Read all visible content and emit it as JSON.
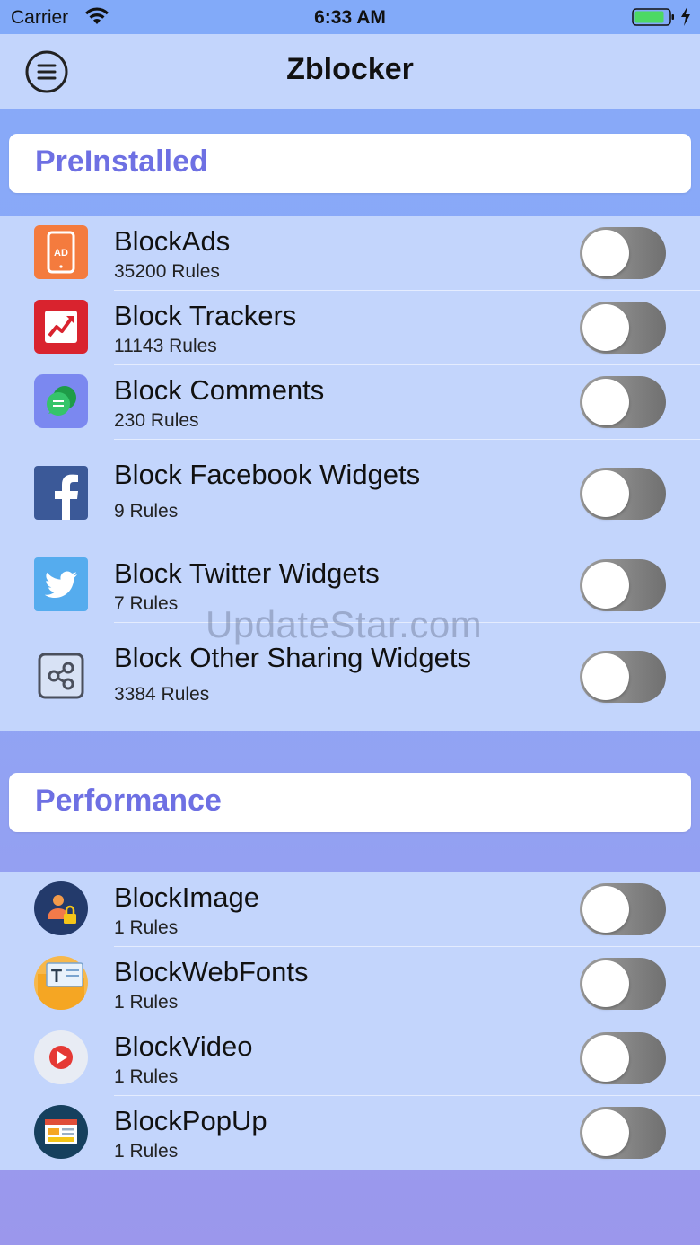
{
  "status_bar": {
    "carrier": "Carrier",
    "time": "6:33 AM"
  },
  "navbar": {
    "title": "Zblocker",
    "menu_icon": "menu-circle-icon"
  },
  "sections": [
    {
      "title": "PreInstalled",
      "items": [
        {
          "name": "BlockAds",
          "rules": "35200 Rules",
          "icon": "ad-phone-icon",
          "enabled": false
        },
        {
          "name": "Block Trackers",
          "rules": "11143 Rules",
          "icon": "trend-chart-icon",
          "enabled": false
        },
        {
          "name": "Block Comments",
          "rules": "230 Rules",
          "icon": "chat-bubbles-icon",
          "enabled": false
        },
        {
          "name": "Block Facebook Widgets",
          "rules": "9 Rules",
          "icon": "facebook-icon",
          "enabled": false
        },
        {
          "name": "Block Twitter Widgets",
          "rules": "7 Rules",
          "icon": "twitter-icon",
          "enabled": false
        },
        {
          "name": "Block Other Sharing Widgets",
          "rules": "3384 Rules",
          "icon": "share-icon",
          "enabled": false
        }
      ]
    },
    {
      "title": "Performance",
      "items": [
        {
          "name": "BlockImage",
          "rules": "1 Rules",
          "icon": "image-lock-icon",
          "enabled": false
        },
        {
          "name": "BlockWebFonts",
          "rules": "1 Rules",
          "icon": "font-folder-icon",
          "enabled": false
        },
        {
          "name": "BlockVideo",
          "rules": "1 Rules",
          "icon": "play-icon",
          "enabled": false
        },
        {
          "name": "BlockPopUp",
          "rules": "1 Rules",
          "icon": "popup-window-icon",
          "enabled": false
        }
      ]
    }
  ],
  "watermark": "UpdateStar.com",
  "colors": {
    "accent": "#6e70e3",
    "row_background": "#c3d5fc",
    "header_background": "#ffffff"
  }
}
